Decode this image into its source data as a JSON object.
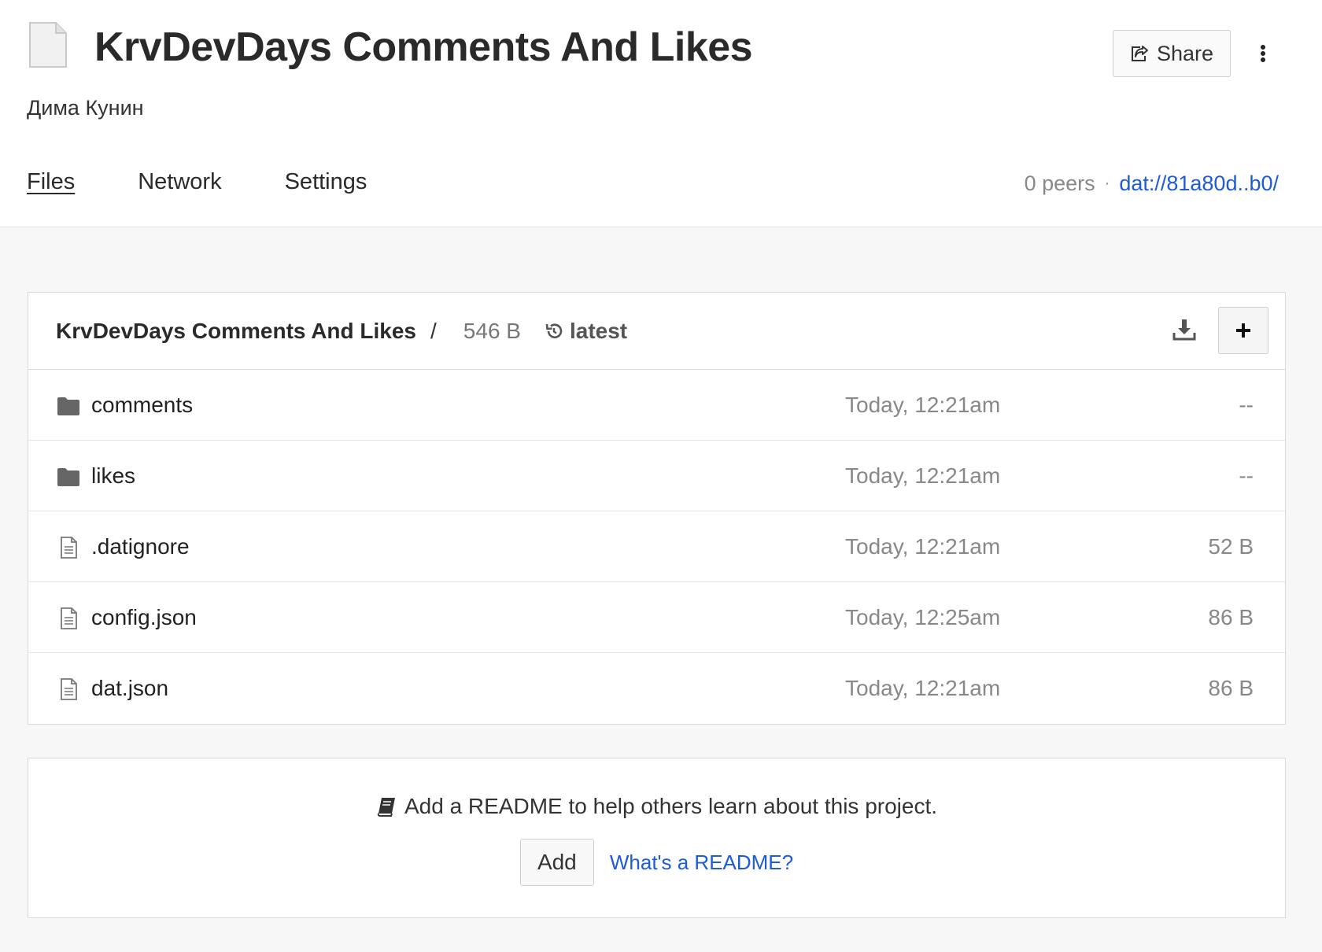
{
  "site": {
    "title": "KrvDevDays Comments And Likes",
    "owner": "Дима Кунин",
    "icon": "document-icon"
  },
  "header": {
    "share_label": "Share",
    "share_icon": "share-icon",
    "menu_icon": "vertical-dots-icon"
  },
  "tabs": [
    {
      "label": "Files",
      "active": true
    },
    {
      "label": "Network",
      "active": false
    },
    {
      "label": "Settings",
      "active": false
    }
  ],
  "network": {
    "peers": "0 peers",
    "separator": "·",
    "url": "dat://81a80d..b0/"
  },
  "files": {
    "breadcrumb": "KrvDevDays Comments And Likes",
    "breadcrumb_sep": "/",
    "total_size": "546 B",
    "version": "latest",
    "rows": [
      {
        "type": "folder",
        "name": "comments",
        "date": "Today, 12:21am",
        "size": "--"
      },
      {
        "type": "folder",
        "name": "likes",
        "date": "Today, 12:21am",
        "size": "--"
      },
      {
        "type": "file",
        "name": ".datignore",
        "date": "Today, 12:21am",
        "size": "52 B"
      },
      {
        "type": "file",
        "name": "config.json",
        "date": "Today, 12:25am",
        "size": "86 B"
      },
      {
        "type": "file",
        "name": "dat.json",
        "date": "Today, 12:21am",
        "size": "86 B"
      }
    ]
  },
  "readme": {
    "message": "Add a README to help others learn about this project.",
    "add_label": "Add",
    "help_link": "What's a README?"
  },
  "colors": {
    "link": "#1e5bd6",
    "muted": "#888888",
    "panel_bg": "#f7f7f7"
  }
}
